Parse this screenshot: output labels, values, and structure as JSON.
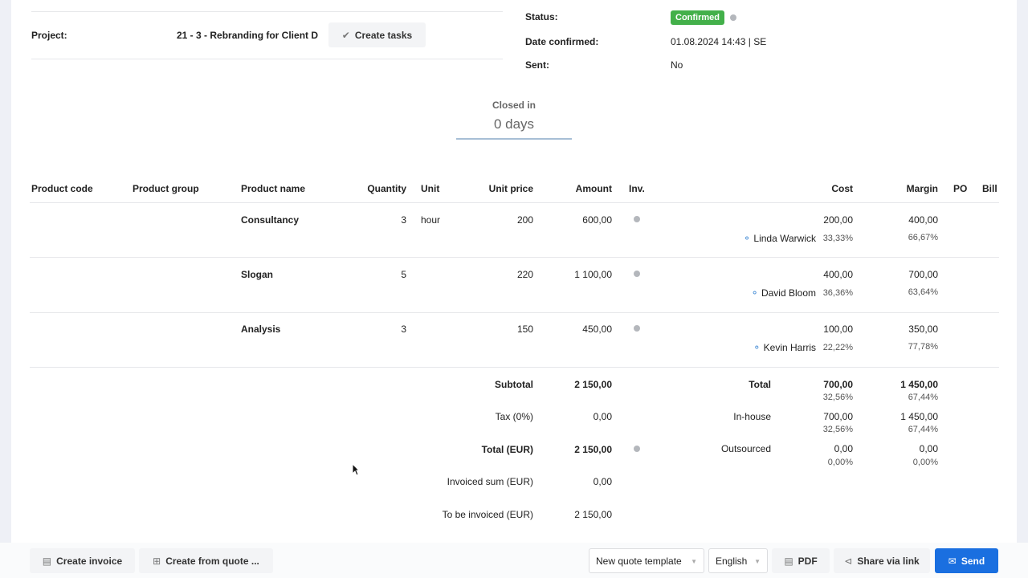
{
  "header": {
    "project_label": "Project:",
    "project_value": "21 - 3 - Rebranding for Client D",
    "create_tasks": "Create tasks",
    "status_label": "Status:",
    "status_value": "Confirmed",
    "status_color": "#43b04a",
    "date_label": "Date confirmed:",
    "date_value": "01.08.2024 14:43 | SE",
    "sent_label": "Sent:",
    "sent_value": "No"
  },
  "closed": {
    "label": "Closed in",
    "value": "0 days"
  },
  "table": {
    "headers": {
      "code": "Product code",
      "group": "Product group",
      "name": "Product name",
      "qty": "Quantity",
      "unit": "Unit",
      "unit_price": "Unit price",
      "amount": "Amount",
      "inv": "Inv.",
      "cost": "Cost",
      "margin": "Margin",
      "po": "PO",
      "bill": "Bill"
    },
    "rows": [
      {
        "name": "Consultancy",
        "qty": "3",
        "unit": "hour",
        "unit_price": "200",
        "amount": "600,00",
        "cost": "200,00",
        "margin": "400,00",
        "person": "Linda Warwick",
        "cost_pct": "33,33%",
        "margin_pct": "66,67%"
      },
      {
        "name": "Slogan",
        "qty": "5",
        "unit": "",
        "unit_price": "220",
        "amount": "1 100,00",
        "cost": "400,00",
        "margin": "700,00",
        "person": "David Bloom",
        "cost_pct": "36,36%",
        "margin_pct": "63,64%"
      },
      {
        "name": "Analysis",
        "qty": "3",
        "unit": "",
        "unit_price": "150",
        "amount": "450,00",
        "cost": "100,00",
        "margin": "350,00",
        "person": "Kevin Harris",
        "cost_pct": "22,22%",
        "margin_pct": "77,78%"
      }
    ]
  },
  "summary": {
    "subtotal_label": "Subtotal",
    "subtotal": "2 150,00",
    "tax_label": "Tax (0%)",
    "tax": "0,00",
    "total_label": "Total (EUR)",
    "total": "2 150,00",
    "invoiced_label": "Invoiced sum (EUR)",
    "invoiced": "0,00",
    "to_invoice_label": "To be invoiced (EUR)",
    "to_invoice": "2 150,00",
    "total_cost_label": "Total",
    "total_cost": "700,00",
    "total_cost_pct": "32,56%",
    "total_margin": "1 450,00",
    "total_margin_pct": "67,44%",
    "inhouse_label": "In-house",
    "inhouse_cost": "700,00",
    "inhouse_cost_pct": "32,56%",
    "inhouse_margin": "1 450,00",
    "inhouse_margin_pct": "67,44%",
    "outsourced_label": "Outsourced",
    "outsourced_cost": "0,00",
    "outsourced_cost_pct": "0,00%",
    "outsourced_margin": "0,00",
    "outsourced_margin_pct": "0,00%"
  },
  "footer": {
    "create_invoice": "Create invoice",
    "create_from_quote": "Create from quote ...",
    "template": "New quote template",
    "language": "English",
    "pdf": "PDF",
    "share": "Share via link",
    "send": "Send",
    "send_color": "#1a6fe0"
  }
}
